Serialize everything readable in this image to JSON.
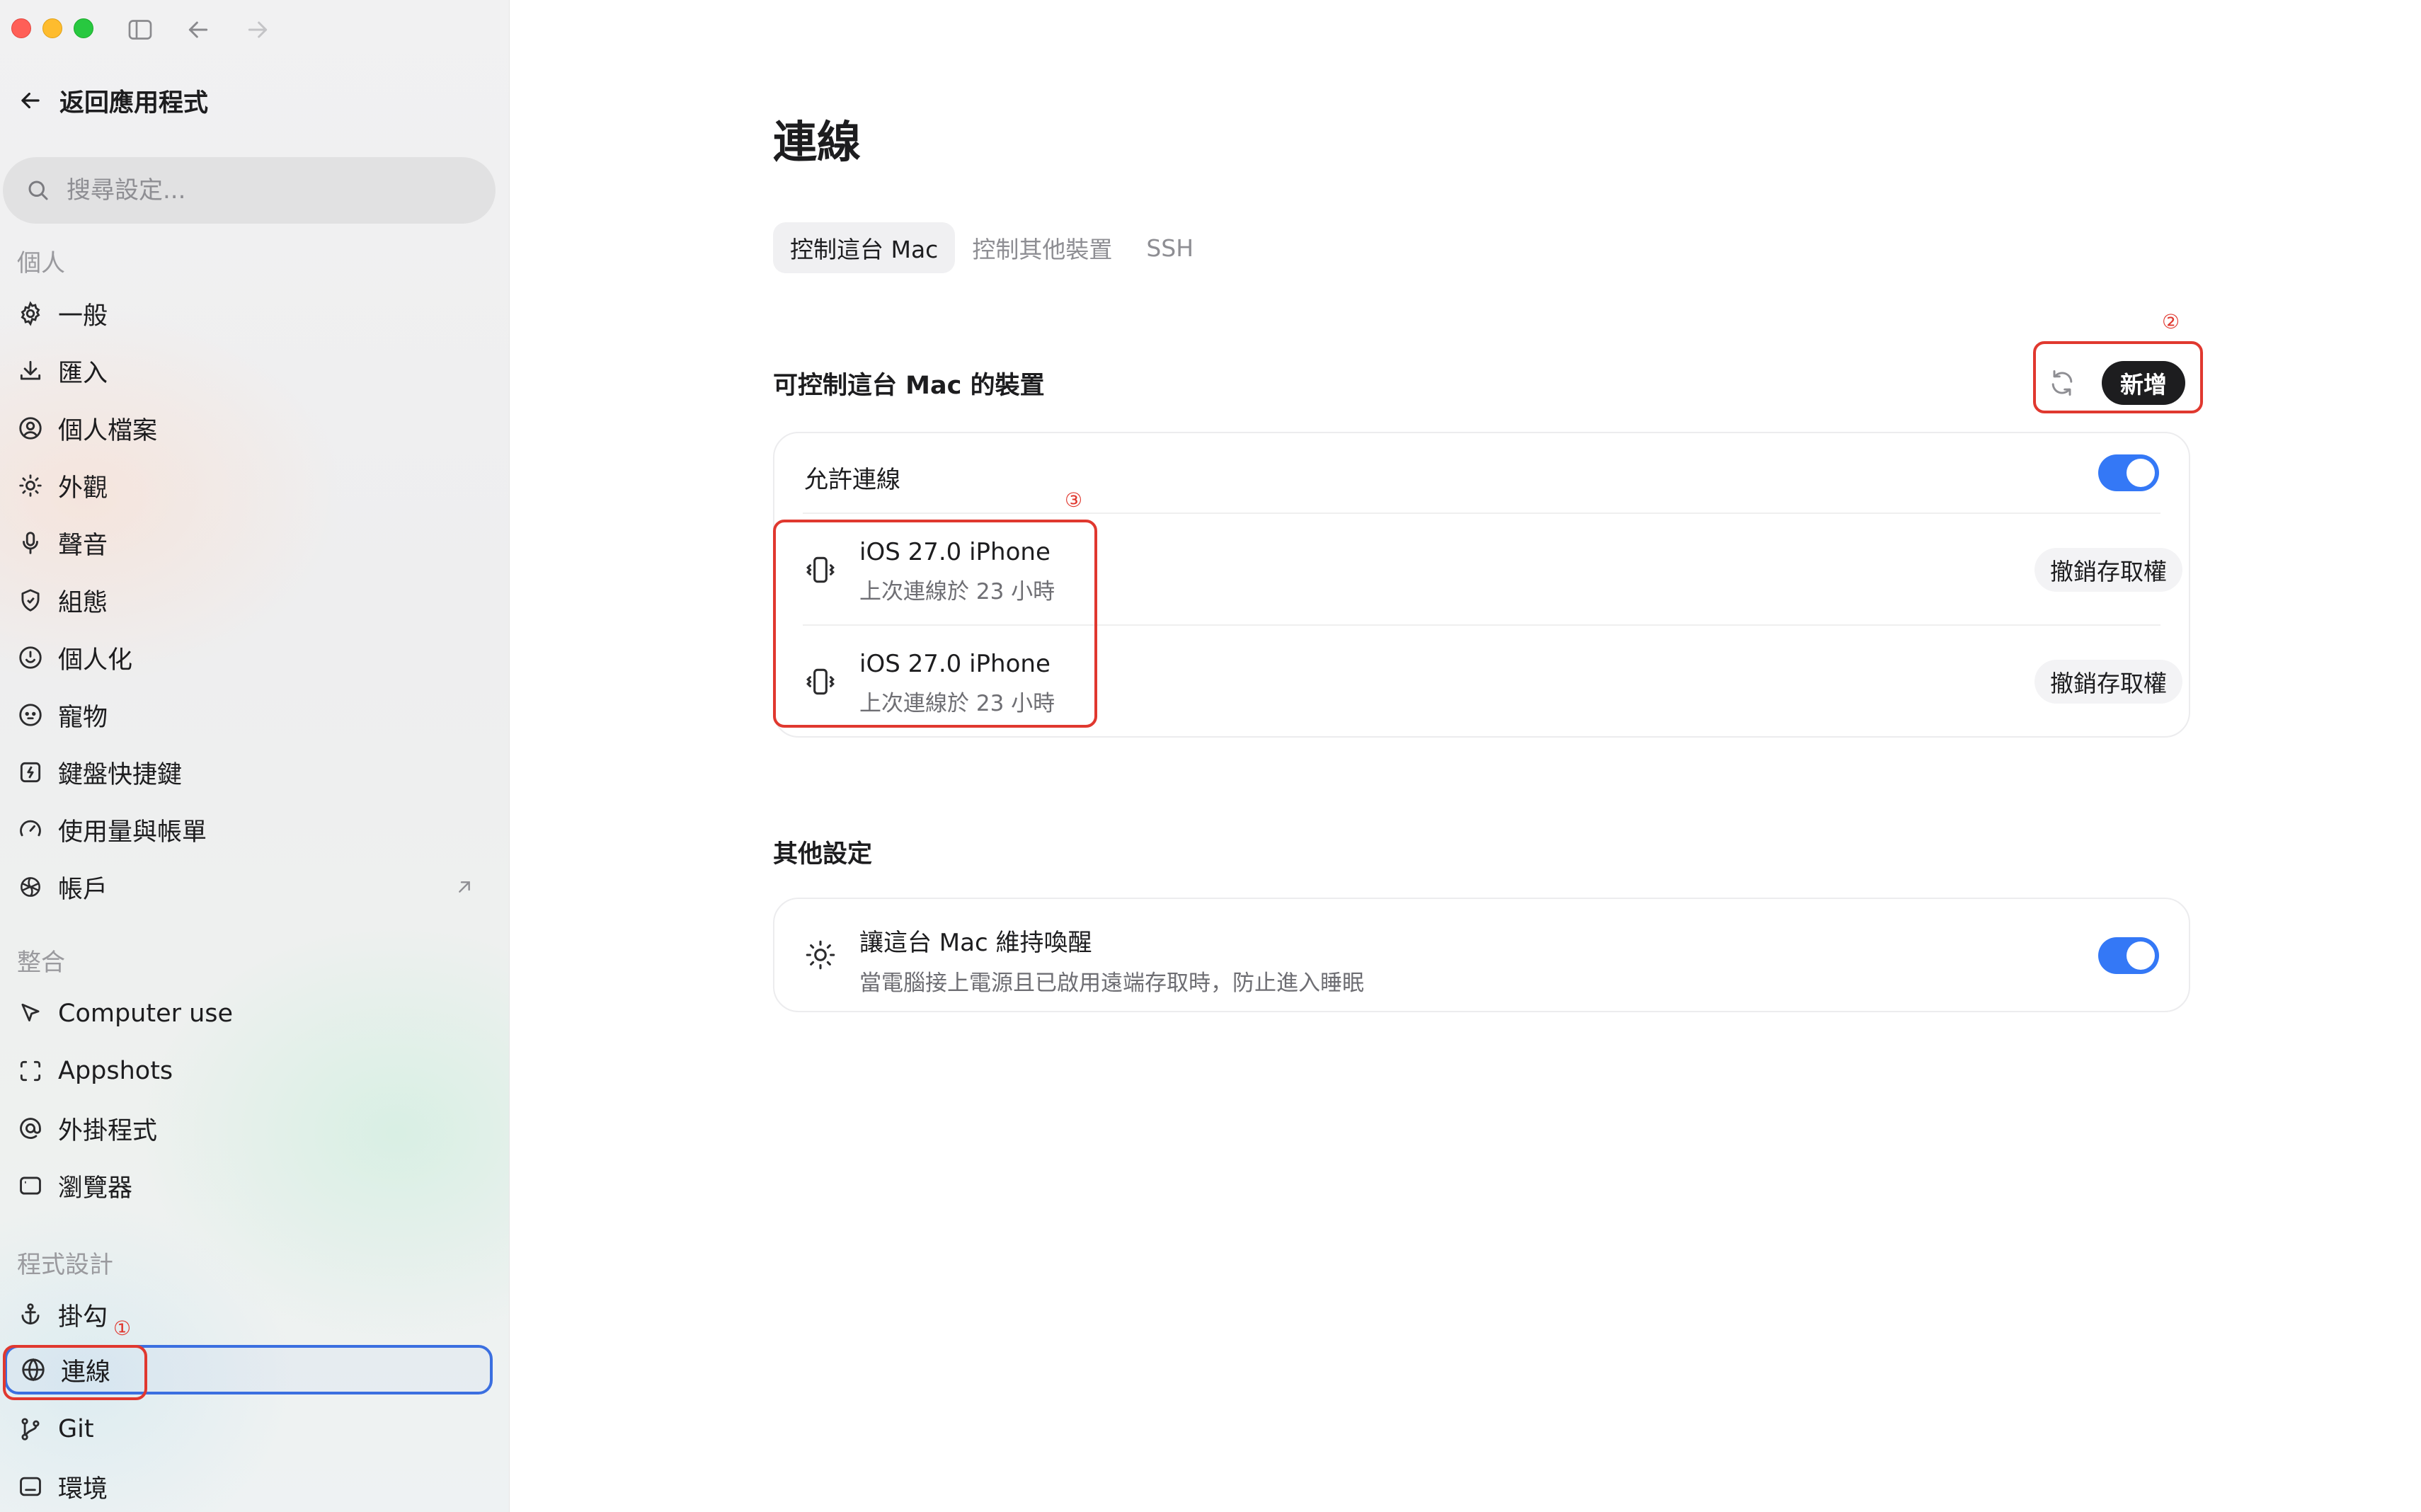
{
  "sidebar": {
    "back_label": "返回應用程式",
    "search_placeholder": "搜尋設定...",
    "sections": {
      "personal": "個人",
      "integrations": "整合",
      "coding": "程式設計"
    },
    "items": {
      "general": "一般",
      "import": "匯入",
      "profile": "個人檔案",
      "appearance": "外觀",
      "voice": "聲音",
      "config": "組態",
      "personalization": "個人化",
      "pets": "寵物",
      "shortcuts": "鍵盤快捷鍵",
      "usage": "使用量與帳單",
      "account": "帳戶",
      "computer_use": "Computer use",
      "appshots": "Appshots",
      "plugins": "外掛程式",
      "browser": "瀏覽器",
      "hooks": "掛勾",
      "connections": "連線",
      "git": "Git",
      "environment": "環境"
    }
  },
  "annotations": {
    "one": "①",
    "two": "②",
    "three": "③"
  },
  "main": {
    "title": "連線",
    "tabs": [
      "控制這台 Mac",
      "控制其他裝置",
      "SSH"
    ],
    "devices_section": {
      "title": "可控制這台 Mac 的裝置",
      "add_label": "新增",
      "allow_label": "允許連線",
      "allow_on": true,
      "devices": [
        {
          "name": "iOS 27.0 iPhone",
          "last_seen": "上次連線於 23 小時",
          "revoke_label": "撤銷存取權"
        },
        {
          "name": "iOS 27.0 iPhone",
          "last_seen": "上次連線於 23 小時",
          "revoke_label": "撤銷存取權"
        }
      ]
    },
    "other_section": {
      "title": "其他設定",
      "keep_awake_title": "讓這台 Mac 維持喚醒",
      "keep_awake_desc": "當電腦接上電源且已啟用遠端存取時，防止進入睡眠",
      "keep_awake_on": true
    }
  },
  "colors": {
    "accent": "#3478f6",
    "annotation": "#e0382f",
    "active_border": "#3b6fe0"
  }
}
